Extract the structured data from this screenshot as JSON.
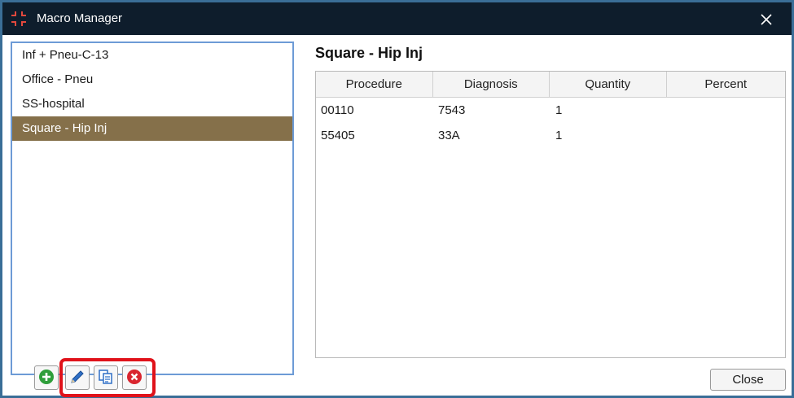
{
  "window": {
    "title": "Macro Manager"
  },
  "macros": {
    "items": [
      {
        "label": "Inf + Pneu-C-13"
      },
      {
        "label": "Office - Pneu"
      },
      {
        "label": "SS-hospital"
      },
      {
        "label": "Square - Hip Inj"
      }
    ],
    "selected_index": 3
  },
  "detail": {
    "title": "Square - Hip Inj",
    "columns": [
      "Procedure",
      "Diagnosis",
      "Quantity",
      "Percent"
    ],
    "rows": [
      [
        "00110",
        "7543",
        "1",
        ""
      ],
      [
        "55405",
        "33A",
        "1",
        ""
      ]
    ]
  },
  "toolbar": {
    "add_icon": "plus-circle-icon",
    "edit_icon": "pencil-icon",
    "copy_icon": "copy-icon",
    "delete_icon": "delete-circle-icon"
  },
  "footer": {
    "close_label": "Close"
  },
  "colors": {
    "titlebar": "#0e1d2c",
    "selected_row": "#85704a",
    "list_border": "#6d9bd6",
    "highlight": "#e0121a",
    "add_green": "#2e9e3a",
    "delete_red": "#d9252f",
    "edit_blue": "#2f6fc6"
  }
}
